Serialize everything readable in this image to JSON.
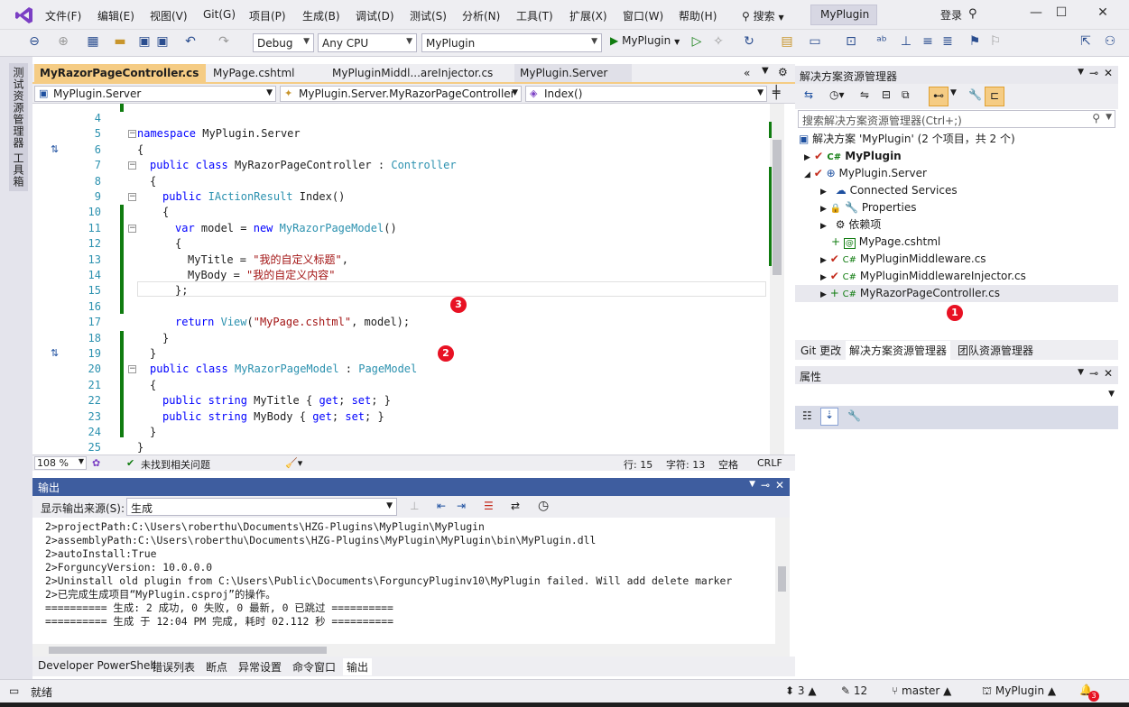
{
  "menu": [
    "文件(F)",
    "编辑(E)",
    "视图(V)",
    "Git(G)",
    "项目(P)",
    "生成(B)",
    "调试(D)",
    "测试(S)",
    "分析(N)",
    "工具(T)",
    "扩展(X)",
    "窗口(W)",
    "帮助(H)"
  ],
  "search_label": "搜索",
  "project_tag": "MyPlugin",
  "login": "登录",
  "toolbar": {
    "config": "Debug",
    "platform": "Any CPU",
    "startup": "MyPlugin",
    "run_label": "MyPlugin"
  },
  "left_rail": {
    "tab1": "测试资源管理器",
    "tab2": "工具箱"
  },
  "editor_tabs": [
    "MyRazorPageController.cs",
    "MyPage.cshtml",
    "MyPluginMiddl...areInjector.cs",
    "MyPlugin.Server"
  ],
  "active_tab_pin": "⊸ ×",
  "nav": {
    "project": "MyPlugin.Server",
    "class": "MyPlugin.Server.MyRazorPageController",
    "member": "Index()"
  },
  "code_lines": [
    {
      "n": "4",
      "t": ""
    },
    {
      "n": "5",
      "t": "namespace MyPlugin.Server"
    },
    {
      "n": "6",
      "t": "{"
    },
    {
      "n": "7",
      "t": "public class MyRazorPageController : Controller"
    },
    {
      "n": "8",
      "t": "{"
    },
    {
      "n": "9",
      "t": "public IActionResult Index()"
    },
    {
      "n": "10",
      "t": "{"
    },
    {
      "n": "11",
      "t": "var model = new MyRazorPageModel()"
    },
    {
      "n": "12",
      "t": "{"
    },
    {
      "n": "13",
      "t": "MyTitle = \"我的自定义标题\","
    },
    {
      "n": "14",
      "t": "MyBody = \"我的自定义内容\""
    },
    {
      "n": "15",
      "t": "};"
    },
    {
      "n": "16",
      "t": ""
    },
    {
      "n": "17",
      "t": "return View(\"MyPage.cshtml\", model);"
    },
    {
      "n": "18",
      "t": "}"
    },
    {
      "n": "19",
      "t": "}"
    },
    {
      "n": "20",
      "t": "public class MyRazorPageModel : PageModel"
    },
    {
      "n": "21",
      "t": "{"
    },
    {
      "n": "22",
      "t": "public string MyTitle { get; set; }"
    },
    {
      "n": "23",
      "t": "public string MyBody { get; set; }"
    },
    {
      "n": "24",
      "t": "}"
    },
    {
      "n": "25",
      "t": "}"
    }
  ],
  "badges": {
    "b1": "1",
    "b2": "2",
    "b3": "3"
  },
  "editor_status": {
    "zoom": "108 %",
    "issues": "未找到相关问题",
    "line": "行: 15",
    "col": "字符: 13",
    "spacing": "空格",
    "eol": "CRLF"
  },
  "output": {
    "title": "输出",
    "source_label": "显示输出来源(S):",
    "source_value": "生成",
    "lines": [
      "2>projectPath:C:\\Users\\roberthu\\Documents\\HZG-Plugins\\MyPlugin\\MyPlugin",
      "2>assemblyPath:C:\\Users\\roberthu\\Documents\\HZG-Plugins\\MyPlugin\\MyPlugin\\bin\\MyPlugin.dll",
      "2>autoInstall:True",
      "2>ForguncyVersion: 10.0.0.0",
      "2>Uninstall old plugin from C:\\Users\\Public\\Documents\\ForguncyPluginv10\\MyPlugin failed. Will add delete marker",
      "2>已完成生成项目“MyPlugin.csproj”的操作。",
      "========== 生成: 2 成功, 0 失败, 0 最新, 0 已跳过 ==========",
      "========== 生成 于 12:04 PM 完成, 耗时 02.112 秒 =========="
    ]
  },
  "bottom_tabs": [
    "Developer PowerShell",
    "错误列表",
    "断点",
    "异常设置",
    "命令窗口",
    "输出"
  ],
  "solution": {
    "title": "解决方案资源管理器",
    "search_placeholder": "搜索解决方案资源管理器(Ctrl+;)",
    "root": "解决方案 'MyPlugin' (2 个项目，共 2 个)",
    "items": [
      {
        "label": "MyPlugin",
        "prefix": "C#"
      },
      {
        "label": "MyPlugin.Server",
        "prefix": "⊕"
      },
      {
        "label": "Connected Services",
        "prefix": "☁"
      },
      {
        "label": "Properties",
        "prefix": "🔧"
      },
      {
        "label": "依赖项",
        "prefix": "⚙"
      },
      {
        "label": "MyPage.cshtml",
        "prefix": "@"
      },
      {
        "label": "MyPluginMiddleware.cs",
        "prefix": "C#"
      },
      {
        "label": "MyPluginMiddlewareInjector.cs",
        "prefix": "C#"
      },
      {
        "label": "MyRazorPageController.cs",
        "prefix": "C#"
      }
    ]
  },
  "sol_tabs": [
    "Git 更改",
    "解决方案资源管理器",
    "团队资源管理器"
  ],
  "properties_title": "属性",
  "statusbar": {
    "ready": "就绪",
    "up": "3",
    "edits": "12",
    "branch": "master",
    "repo": "MyPlugin",
    "notif": "3"
  }
}
